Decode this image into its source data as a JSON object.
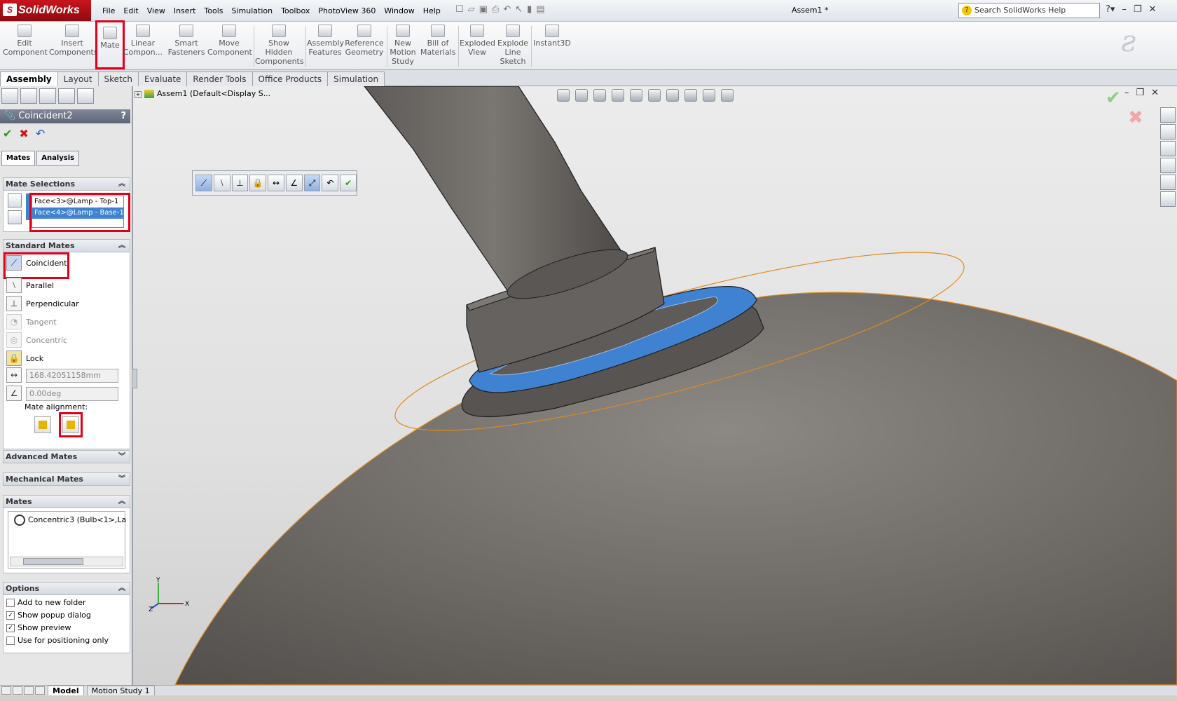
{
  "app": {
    "name": "SolidWorks",
    "document_title": "Assem1 *",
    "menu": [
      "File",
      "Edit",
      "View",
      "Insert",
      "Tools",
      "Simulation",
      "Toolbox",
      "PhotoView 360",
      "Window",
      "Help"
    ],
    "search_placeholder": "Search SolidWorks Help"
  },
  "command_manager": {
    "buttons": [
      {
        "label": "Edit\nComponent"
      },
      {
        "label": "Insert\nComponents"
      },
      {
        "label": "Mate"
      },
      {
        "label": "Linear\nCompon..."
      },
      {
        "label": "Smart\nFasteners"
      },
      {
        "label": "Move\nComponent"
      },
      {
        "label": "Show\nHidden\nComponents"
      },
      {
        "label": "Assembly\nFeatures"
      },
      {
        "label": "Reference\nGeometry"
      },
      {
        "label": "New\nMotion\nStudy"
      },
      {
        "label": "Bill of\nMaterials"
      },
      {
        "label": "Exploded\nView"
      },
      {
        "label": "Explode\nLine\nSketch"
      },
      {
        "label": "Instant3D"
      }
    ],
    "tabs": [
      "Assembly",
      "Layout",
      "Sketch",
      "Evaluate",
      "Render Tools",
      "Office Products",
      "Simulation"
    ],
    "active_tab": "Assembly"
  },
  "property_manager": {
    "title": "Coincident2",
    "help": "?",
    "tabs": [
      "Mates",
      "Analysis"
    ],
    "mate_selections": {
      "header": "Mate Selections",
      "items": [
        "Face<3>@Lamp - Top-1",
        "Face<4>@Lamp - Base-1"
      ]
    },
    "standard_mates": {
      "header": "Standard Mates",
      "items": [
        "Coincident",
        "Parallel",
        "Perpendicular",
        "Tangent",
        "Concentric",
        "Lock"
      ],
      "distance_value": "168.42051158mm",
      "angle_value": "0.00deg",
      "alignment_label": "Mate alignment:"
    },
    "advanced_mates_header": "Advanced Mates",
    "mechanical_mates_header": "Mechanical Mates",
    "mates": {
      "header": "Mates",
      "items": [
        "Concentric3 (Bulb<1>,La"
      ]
    },
    "options": {
      "header": "Options",
      "items": [
        {
          "label": "Add to new folder",
          "checked": false
        },
        {
          "label": "Show popup dialog",
          "checked": true
        },
        {
          "label": "Show preview",
          "checked": true
        },
        {
          "label": "Use for positioning only",
          "checked": false
        }
      ]
    }
  },
  "viewport": {
    "tree_label": "Assem1  (Default<Display S...",
    "triad_axes": {
      "x": "X",
      "y": "Y",
      "z": "Z"
    }
  },
  "bottom_tabs": [
    "Model",
    "Motion Study 1"
  ],
  "colors": {
    "selection_blue": "#3e82d1",
    "highlight_red": "#e0001b",
    "edge_orange": "#e08a1e",
    "model_gray": "#6e6a66"
  }
}
